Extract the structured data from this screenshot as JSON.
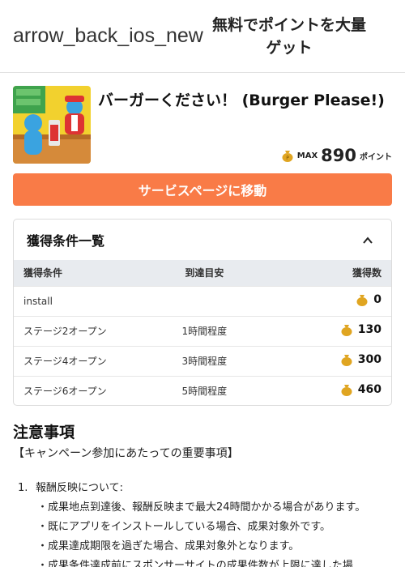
{
  "header": {
    "back_icon_text": "arrow_back_ios_new",
    "title": "無料でポイントを大量ゲット"
  },
  "app": {
    "name": "バーガーください！ (Burger Please!)",
    "max_label": "MAX",
    "max_points": "890",
    "points_unit": "ポイント"
  },
  "service_button": "サービスページに移動",
  "conditions": {
    "title": "獲得条件一覧",
    "columns": [
      "獲得条件",
      "到達目安",
      "獲得数"
    ],
    "rows": [
      {
        "condition": "install",
        "eta": "",
        "points": "0"
      },
      {
        "condition": "ステージ2オープン",
        "eta": "1時間程度",
        "points": "130"
      },
      {
        "condition": "ステージ4オープン",
        "eta": "3時間程度",
        "points": "300"
      },
      {
        "condition": "ステージ6オープン",
        "eta": "5時間程度",
        "points": "460"
      }
    ]
  },
  "notice": {
    "title": "注意事項",
    "subtitle": "【キャンペーン参加にあたっての重要事項】",
    "item1_number": "1.",
    "item1_heading": "報酬反映について:",
    "bullets": [
      "・成果地点到達後、報酬反映まで最大24時間かかる場合があります。",
      "・既にアプリをインストールしている場合、成果対象外です。",
      "・成果達成期限を過ぎた場合、成果対象外となります。",
      "・成果条件達成前にスポンサーサイトの成果件数が上限に達した場"
    ]
  },
  "colors": {
    "accent": "#f97b47",
    "table_header_bg": "#e8ebef",
    "coin": "#e0a521"
  }
}
